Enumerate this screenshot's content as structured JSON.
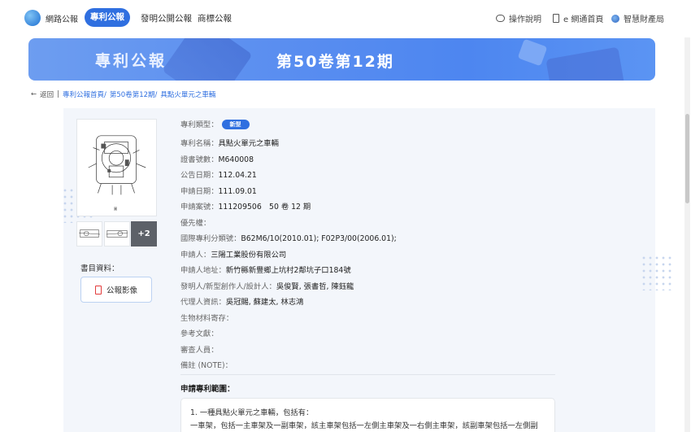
{
  "nav": {
    "logo_text": "網路公報",
    "active_tab": "專利公報",
    "links": [
      "發明公開公報",
      "商標公報"
    ],
    "right": [
      "操作說明",
      "e 網通首頁",
      "智慧財產局"
    ]
  },
  "banner": {
    "left_text": "專利公報",
    "right_text": "第50卷第12期"
  },
  "breadcrumb": {
    "back": "返回",
    "items": [
      "專利公報首頁/",
      "第50卷第12期/",
      "具點火單元之車輛"
    ]
  },
  "thumbs": {
    "more": "+2"
  },
  "sidebar": {
    "biblio_label": "書目資料：",
    "image_button": "公報影像"
  },
  "fields": [
    {
      "k": "專利類型：",
      "v": "",
      "badge": "新型"
    },
    {
      "k": "專利名稱：",
      "v": "具點火單元之車輛"
    },
    {
      "k": "證書號數：",
      "v": "M640008"
    },
    {
      "k": "公告日期：",
      "v": "112.04.21"
    },
    {
      "k": "申請日期：",
      "v": "111.09.01"
    },
    {
      "k": "申請案號：",
      "v": "111209506　50 卷 12 期"
    },
    {
      "k": "優先權：",
      "v": ""
    },
    {
      "k": "國際專利分類號：",
      "v": "B62M6/10(2010.01); F02P3/00(2006.01);"
    },
    {
      "k": "申請人：",
      "v": "三陽工業股份有限公司"
    },
    {
      "k": "申請人地址：",
      "v": "新竹縣新豐鄉上坑村2鄰坑子口184號"
    },
    {
      "k": "發明人/新型創作人/設計人：",
      "v": "吳俊賢, 張書哲, 陳鈺龍"
    },
    {
      "k": "代理人資訊：",
      "v": "吳冠賜, 蘇建太, 林志鴻"
    },
    {
      "k": "生物材料寄存：",
      "v": ""
    },
    {
      "k": "參考文獻：",
      "v": ""
    },
    {
      "k": "審查人員：",
      "v": ""
    },
    {
      "k": "備註 (NOTE)：",
      "v": ""
    }
  ],
  "claims": {
    "heading": "申請專利範圍：",
    "lines": [
      "1. 一種具點火單元之車輛，包括有：",
      "一車架，包括一主車架及一副車架，該主車架包括一左側主車架及一右側主車架，該副車架包括一左側副"
    ]
  },
  "colors": {
    "accent": "#2f6fe0",
    "panel": "#f3f6fb",
    "badge": "#2f6fe0"
  }
}
